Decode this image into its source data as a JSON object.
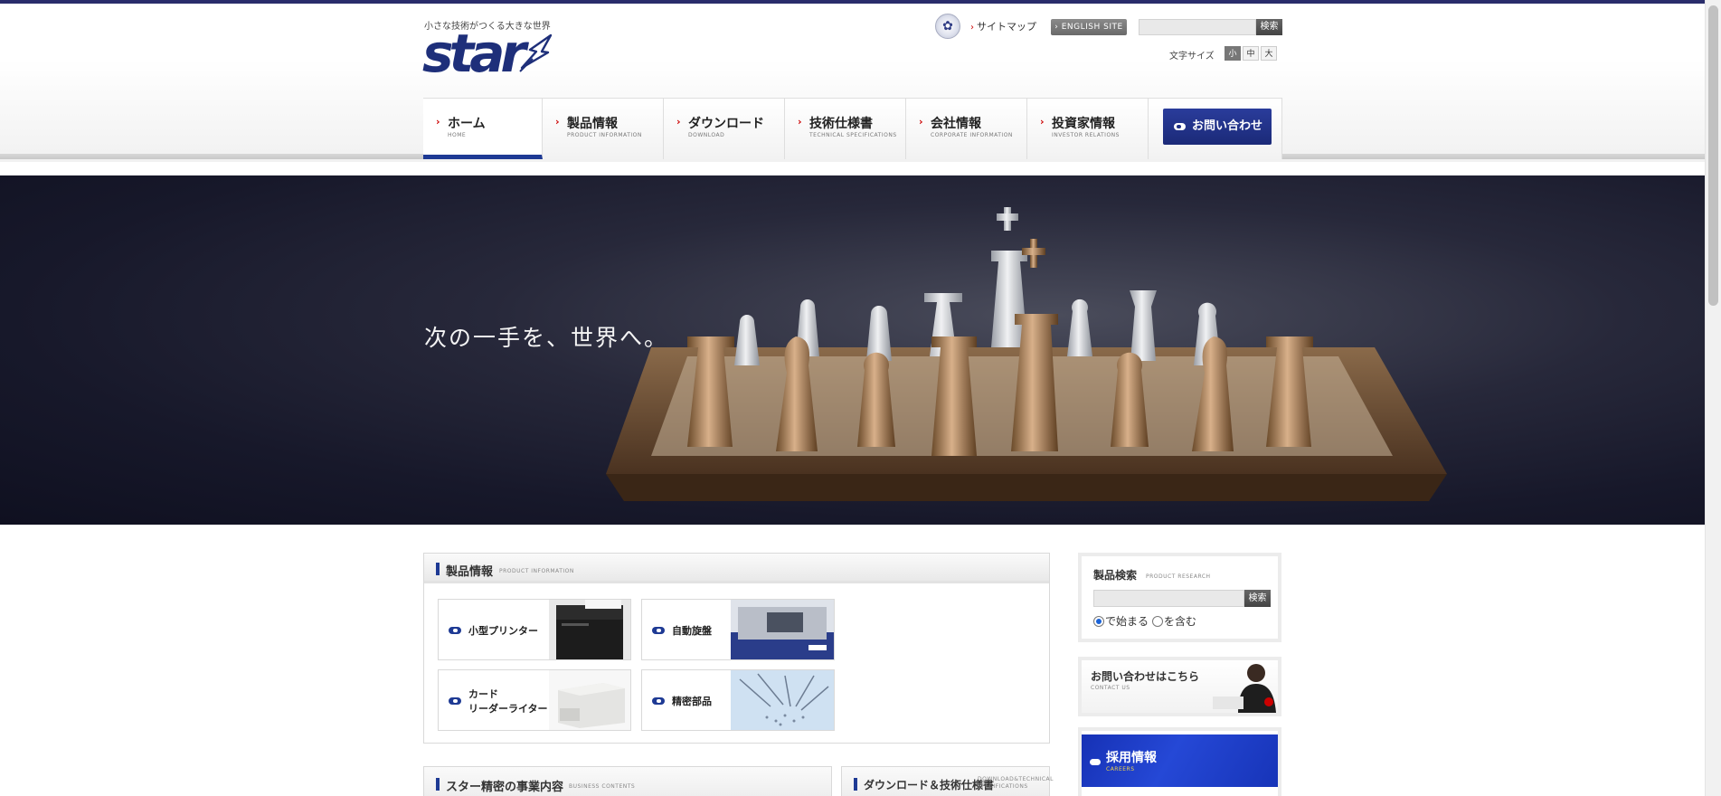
{
  "header": {
    "tagline": "小さな技術がつくる大きな世界",
    "logo_text": "star",
    "sitemap_label": "サイトマップ",
    "english_site_label": "ENGLISH SITE",
    "search_placeholder": "",
    "search_button": "検索",
    "font_size_label": "文字サイズ",
    "font_sizes": [
      "小",
      "中",
      "大"
    ]
  },
  "nav": {
    "items": [
      {
        "ja": "ホーム",
        "en": "HOME"
      },
      {
        "ja": "製品情報",
        "en": "PRODUCT INFORMATION"
      },
      {
        "ja": "ダウンロード",
        "en": "DOWNLOAD"
      },
      {
        "ja": "技術仕様書",
        "en": "TECHNICAL SPECIFICATIONS"
      },
      {
        "ja": "会社情報",
        "en": "CORPORATE INFORMATION"
      },
      {
        "ja": "投資家情報",
        "en": "INVESTOR RELATIONS"
      }
    ],
    "contact_button": "お問い合わせ"
  },
  "hero": {
    "headline": "次の一手を、世界へ。"
  },
  "products": {
    "title": "製品情報",
    "subtitle": "PRODUCT INFORMATION",
    "items": [
      {
        "label": "小型プリンター"
      },
      {
        "label": "自動旋盤"
      },
      {
        "label": "カード\nリーダーライター"
      },
      {
        "label": "精密部品"
      }
    ]
  },
  "sections": {
    "business_title": "スター精密の事業内容",
    "business_sub": "BUSINESS CONTENTS",
    "download_title": "ダウンロード＆技術仕様書",
    "download_sub": "DOWNLOAD&TECHNICAL SPECIFICATIONS"
  },
  "sidebar": {
    "product_search": {
      "title": "製品検索",
      "subtitle": "PRODUCT RESEARCH",
      "button": "検索",
      "options": [
        "で始まる",
        "を含む"
      ],
      "selected": "で始まる"
    },
    "contact": {
      "title": "お問い合わせはこちら",
      "subtitle": "CONTACT US"
    },
    "careers": {
      "title": "採用情報",
      "subtitle": "CAREERS"
    }
  },
  "colors": {
    "brand_navy": "#1e3a94",
    "top_stripe": "#2a2d6b",
    "accent_red": "#cc0000"
  }
}
